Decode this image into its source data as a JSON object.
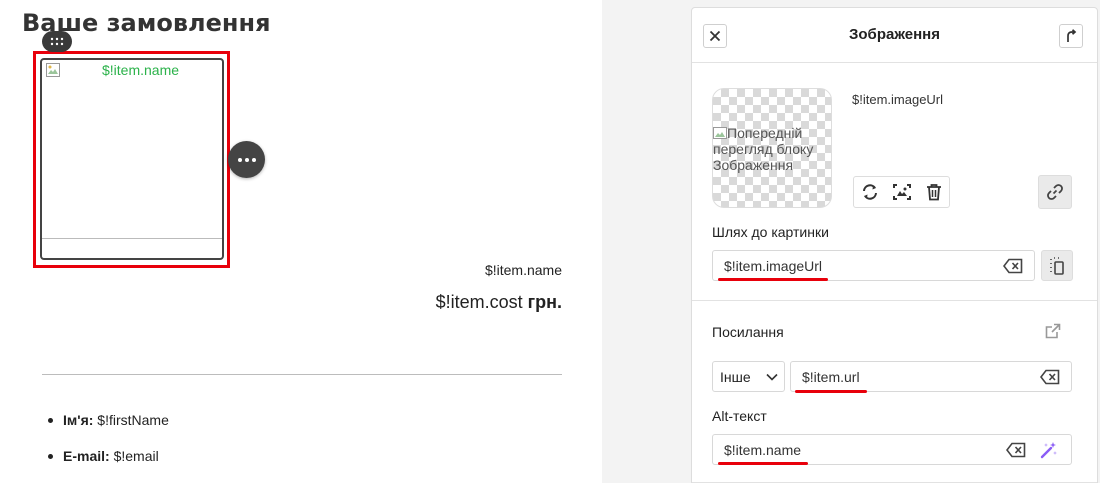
{
  "canvas": {
    "title": "Ваше замовлення",
    "image_block_alt": "$!item.name",
    "item_name": "$!item.name",
    "item_cost": "$!item.cost",
    "currency": "грн.",
    "details": [
      {
        "label": "Ім'я:",
        "value": "$!firstName"
      },
      {
        "label": "E-mail:",
        "value": "$!email"
      }
    ]
  },
  "panel": {
    "title": "Зображення",
    "preview_alt": "Попередній перегляд блоку Зображення",
    "preview_url": "$!item.imageUrl",
    "image_path_label": "Шлях до картинки",
    "image_path_value": "$!item.imageUrl",
    "link_label": "Посилання",
    "link_type_selected": "Інше",
    "link_value": "$!item.url",
    "alt_label": "Alt-текст",
    "alt_value": "$!item.name"
  },
  "colors": {
    "selection": "#e8000b",
    "alt_text_green": "#2bb24a",
    "magic_wand": "#8a5cf6"
  },
  "icons": [
    "drag-handle-icon",
    "more-options-icon",
    "close-icon",
    "pin-icon",
    "replace-icon",
    "crop-icon",
    "trash-icon",
    "link-icon",
    "clear-icon",
    "copy-icon",
    "external-link-icon",
    "chevron-down-icon",
    "magic-wand-icon"
  ]
}
